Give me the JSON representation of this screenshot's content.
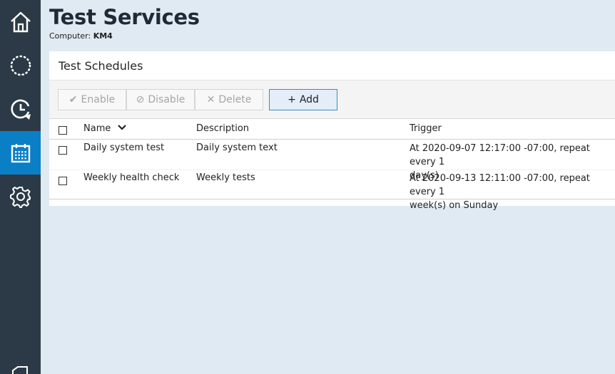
{
  "sidebar": {
    "items": [
      {
        "icon": "home-icon"
      },
      {
        "icon": "dotted-circle-icon"
      },
      {
        "icon": "clock-refresh-icon"
      },
      {
        "icon": "calendar-icon",
        "active": true
      },
      {
        "icon": "gear-icon"
      }
    ]
  },
  "header": {
    "title": "Test Services",
    "computer_label": "Computer:",
    "computer_name": "KM4"
  },
  "panel": {
    "title": "Test Schedules"
  },
  "toolbar": {
    "enable_label": "Enable",
    "disable_label": "Disable",
    "delete_label": "Delete",
    "add_label": "Add"
  },
  "table": {
    "columns": [
      "Name",
      "Description",
      "Trigger"
    ],
    "sort_column": "Name",
    "rows": [
      {
        "name": "Daily system test",
        "description": "Daily system text",
        "trigger_line1": "At 2020-09-07 12:17:00 -07:00, repeat every 1",
        "trigger_line2": "day(s)"
      },
      {
        "name": "Weekly health check",
        "description": "Weekly tests",
        "trigger_line1": "At 2020-09-13 12:11:00 -07:00, repeat every 1",
        "trigger_line2": "week(s) on Sunday"
      }
    ]
  },
  "colors": {
    "sidebar_bg": "#2c3a47",
    "active_nav": "#0a7fc6",
    "page_bg": "#dfeaf3",
    "add_border": "#3c8cc4"
  }
}
